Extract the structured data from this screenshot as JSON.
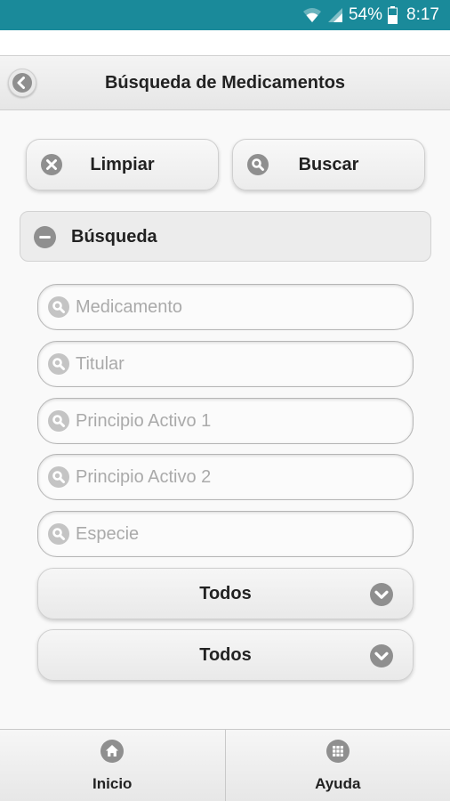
{
  "status_bar": {
    "battery": "54%",
    "time": "8:17",
    "icons": [
      "wifi-icon",
      "signal-icon",
      "battery-icon"
    ]
  },
  "header": {
    "title": "Búsqueda de Medicamentos",
    "back_icon": "back-arrow-icon"
  },
  "actions": {
    "clear_label": "Limpiar",
    "search_label": "Buscar"
  },
  "search_section": {
    "title": "Búsqueda",
    "fields": [
      {
        "placeholder": "Medicamento",
        "value": ""
      },
      {
        "placeholder": "Titular",
        "value": ""
      },
      {
        "placeholder": "Principio Activo 1",
        "value": ""
      },
      {
        "placeholder": "Principio Activo 2",
        "value": ""
      },
      {
        "placeholder": "Especie",
        "value": ""
      }
    ],
    "selects": [
      {
        "value": "Todos"
      },
      {
        "value": "Todos"
      }
    ]
  },
  "footer": {
    "tabs": [
      {
        "label": "Inicio",
        "icon": "home-icon"
      },
      {
        "label": "Ayuda",
        "icon": "grid-icon"
      }
    ]
  },
  "colors": {
    "status_bar": "#1a8a9a",
    "icon_gray": "#9a9a9a",
    "background": "#f9f9f9"
  }
}
